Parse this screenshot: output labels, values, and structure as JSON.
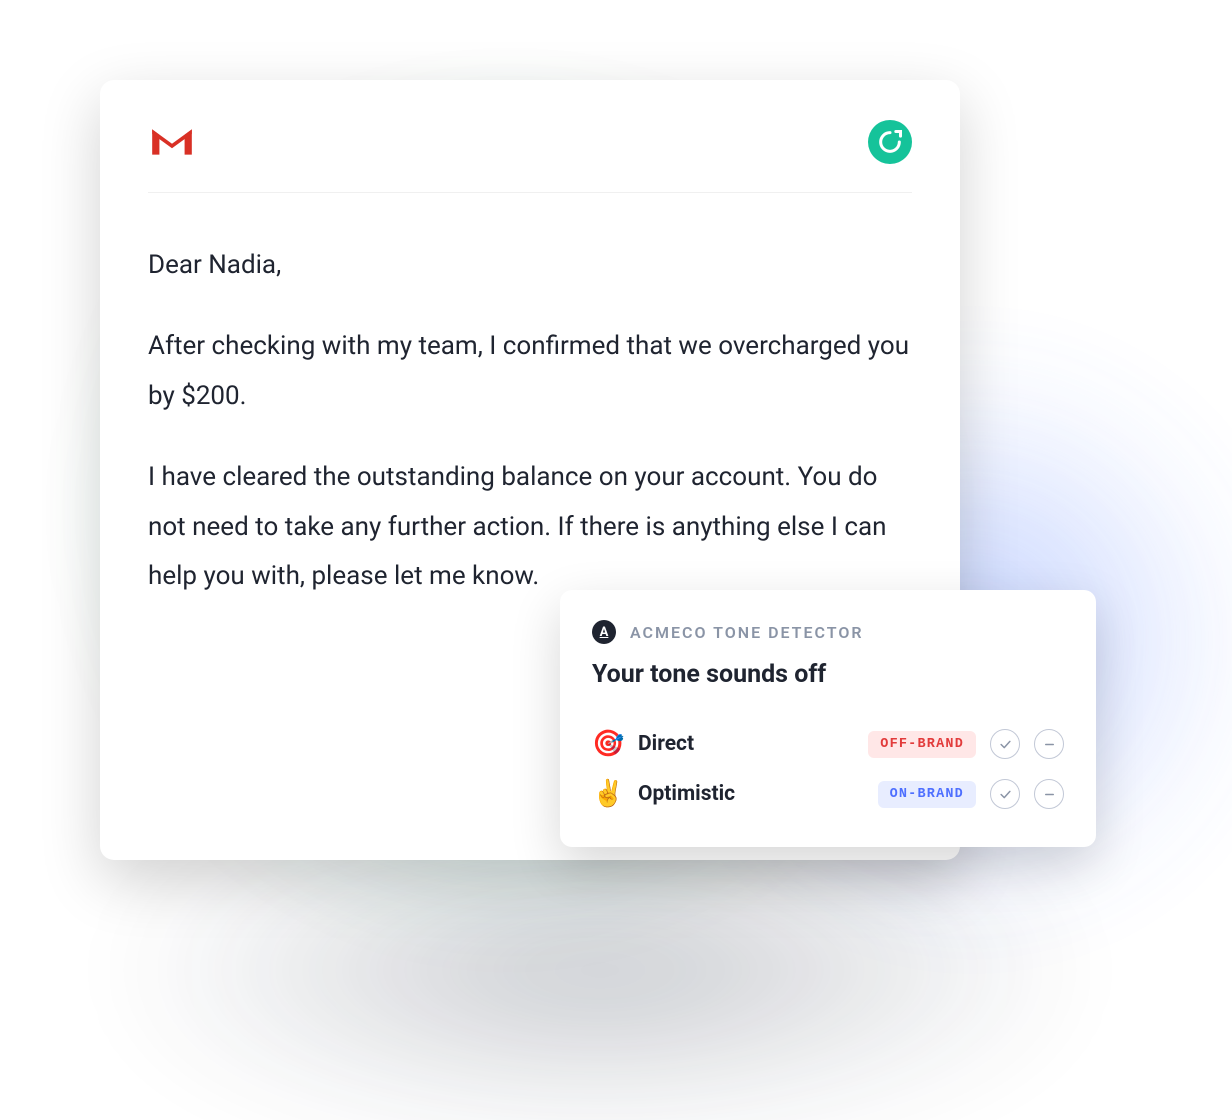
{
  "email": {
    "greeting": "Dear Nadia,",
    "paragraph1": "After checking with my team, I confirmed that we overcharged you by $200.",
    "paragraph2": "I have cleared the outstanding balance on your account. You do not need to take any further action. If there is anything else I can help you with, please let me know."
  },
  "tone_detector": {
    "brand_badge": "A",
    "title": "ACMECO TONE DETECTOR",
    "heading": "Your tone sounds off",
    "rows": [
      {
        "emoji": "🎯",
        "name": "Direct",
        "badge_text": "OFF-BRAND",
        "badge_kind": "off"
      },
      {
        "emoji": "✌️",
        "name": "Optimistic",
        "badge_text": "ON-BRAND",
        "badge_kind": "on"
      }
    ]
  }
}
